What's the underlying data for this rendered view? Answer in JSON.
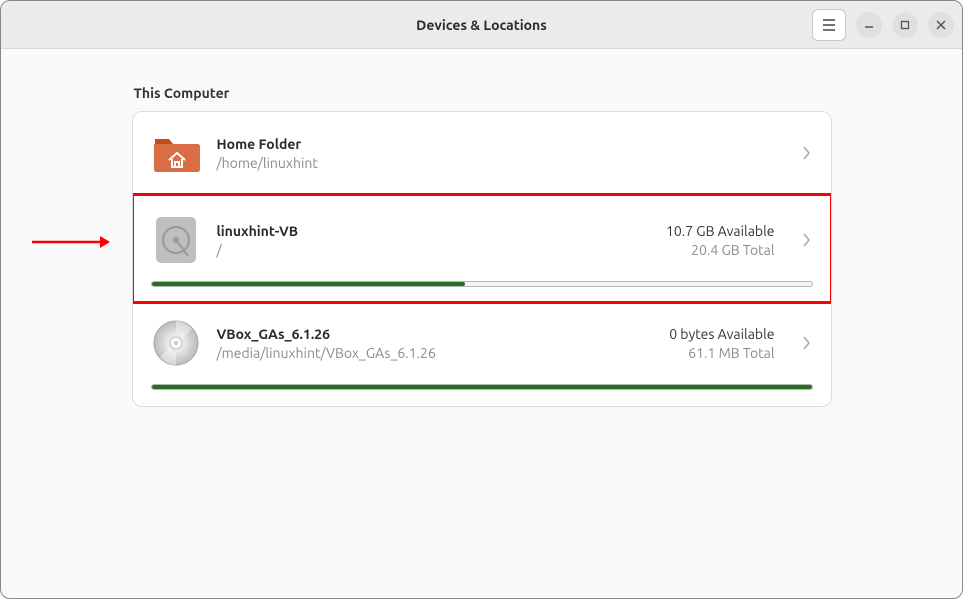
{
  "titlebar": {
    "title": "Devices & Locations"
  },
  "section": {
    "title": "This Computer"
  },
  "rows": [
    {
      "title": "Home Folder",
      "subtitle": "/home/linuxhint",
      "available": "",
      "total": "",
      "progress_pct": null,
      "icon": "home-folder"
    },
    {
      "title": "linuxhint-VB",
      "subtitle": "/",
      "available": "10.7 GB Available",
      "total": "20.4 GB Total",
      "progress_pct": 47.5,
      "icon": "hdd"
    },
    {
      "title": "VBox_GAs_6.1.26",
      "subtitle": "/media/linuxhint/VBox_GAs_6.1.26",
      "available": "0 bytes Available",
      "total": "61.1 MB Total",
      "progress_pct": 100,
      "icon": "disc"
    }
  ],
  "annotation": {
    "highlight_color": "#f60404",
    "highlight_row_index": 1
  }
}
